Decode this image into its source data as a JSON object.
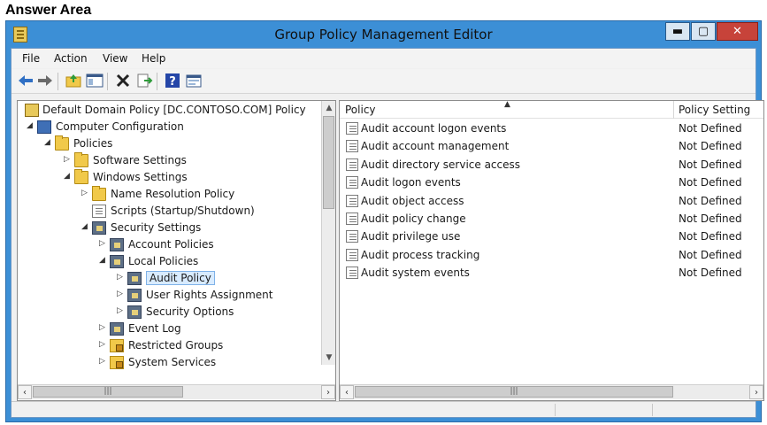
{
  "answer_area": "Answer Area",
  "window": {
    "title": "Group Policy Management Editor",
    "buttons": {
      "minimize": "▬",
      "maximize": "▢",
      "close": "✕"
    }
  },
  "menu": [
    "File",
    "Action",
    "View",
    "Help"
  ],
  "toolbar": {
    "icons": [
      "back-icon",
      "forward-icon",
      "up-folder-icon",
      "show-hide-tree-icon",
      "delete-icon",
      "export-icon",
      "help-icon",
      "properties-icon"
    ]
  },
  "tree": {
    "items": [
      {
        "label": "Default Domain Policy [DC.CONTOSO.COM] Policy",
        "icon": "policy-icon",
        "arrow": ""
      },
      {
        "label": "Computer Configuration",
        "icon": "computer-icon",
        "arrow": "◢"
      },
      {
        "label": "Policies",
        "icon": "folder-icon",
        "arrow": "◢"
      },
      {
        "label": "Software Settings",
        "icon": "folder-icon",
        "arrow": "▷"
      },
      {
        "label": "Windows Settings",
        "icon": "folder-icon",
        "arrow": "◢"
      },
      {
        "label": "Name Resolution Policy",
        "icon": "folder-icon",
        "arrow": "▷"
      },
      {
        "label": "Scripts (Startup/Shutdown)",
        "icon": "script-icon",
        "arrow": ""
      },
      {
        "label": "Security Settings",
        "icon": "security-icon",
        "arrow": "◢"
      },
      {
        "label": "Account Policies",
        "icon": "policy-folder-icon",
        "arrow": "▷"
      },
      {
        "label": "Local Policies",
        "icon": "policy-folder-icon",
        "arrow": "◢"
      },
      {
        "label": "Audit Policy",
        "icon": "policy-folder-icon",
        "arrow": "▷",
        "selected": true
      },
      {
        "label": "User Rights Assignment",
        "icon": "policy-folder-icon",
        "arrow": "▷"
      },
      {
        "label": "Security Options",
        "icon": "policy-folder-icon",
        "arrow": "▷"
      },
      {
        "label": "Event Log",
        "icon": "policy-folder-icon",
        "arrow": "▷"
      },
      {
        "label": "Restricted Groups",
        "icon": "lock-folder-icon",
        "arrow": "▷"
      },
      {
        "label": "System Services",
        "icon": "lock-folder-icon",
        "arrow": "▷"
      }
    ]
  },
  "list": {
    "columns": [
      "Policy",
      "Policy Setting"
    ],
    "rows": [
      {
        "policy": "Audit account logon events",
        "setting": "Not Defined"
      },
      {
        "policy": "Audit account management",
        "setting": "Not Defined"
      },
      {
        "policy": "Audit directory service access",
        "setting": "Not Defined"
      },
      {
        "policy": "Audit logon events",
        "setting": "Not Defined"
      },
      {
        "policy": "Audit object access",
        "setting": "Not Defined"
      },
      {
        "policy": "Audit policy change",
        "setting": "Not Defined"
      },
      {
        "policy": "Audit privilege use",
        "setting": "Not Defined"
      },
      {
        "policy": "Audit process tracking",
        "setting": "Not Defined"
      },
      {
        "policy": "Audit system events",
        "setting": "Not Defined"
      }
    ]
  }
}
